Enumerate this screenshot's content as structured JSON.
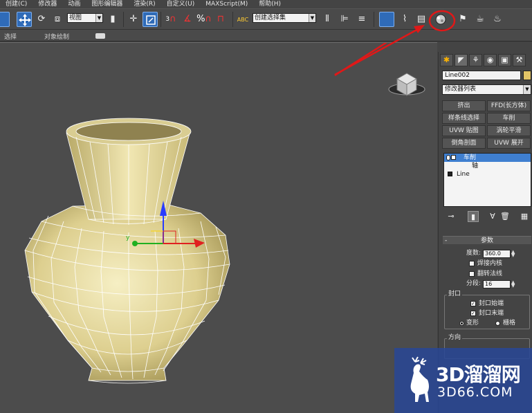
{
  "menu": {
    "items": [
      "创建(C)",
      "修改器",
      "动画",
      "图形编辑器",
      "渲染(R)",
      "自定义(U)",
      "MAXScript(M)",
      "帮助(H)"
    ]
  },
  "toolbar": {
    "view_dropdown": "视图",
    "selection_set_dropdown": "创建选择集",
    "snap_3": "3",
    "snap_percent": "%",
    "abc_label": "ABC"
  },
  "subbar": {
    "select_label": "选择",
    "object_paint_label": "对象绘制"
  },
  "viewport": {
    "axis_y_label": "y",
    "background": "#4c4c4c",
    "vase_color": "#e8dda6"
  },
  "command_panel": {
    "tabs": [
      "✱",
      "◤",
      "⚘",
      "◉",
      "▣",
      "⚒"
    ],
    "object_name": "Line002",
    "object_color": "#e2c466",
    "modifier_list": "修改器列表",
    "modifier_buttons": [
      "挤出",
      "FFD(长方体)",
      "样条线选择",
      "车削",
      "UVW 贴图",
      "涡轮平滑",
      "倒角剖面",
      "UVW 展开"
    ],
    "stack": {
      "lathe": "车削",
      "axis": "轴",
      "line": "Line"
    },
    "params": {
      "title": "参数",
      "degrees_label": "度数:",
      "degrees_value": "360.0",
      "weld_core": "焊接内核",
      "flip_normals": "翻转法线",
      "segments_label": "分段:",
      "segments_value": "16",
      "capping_title": "封口",
      "cap_start": "封口始端",
      "cap_end": "封口末端",
      "morph": "变形",
      "grid": "栅格",
      "direction_title": "方向"
    }
  },
  "watermark": {
    "brand": "3D溜溜网",
    "site": "3D66.COM"
  }
}
